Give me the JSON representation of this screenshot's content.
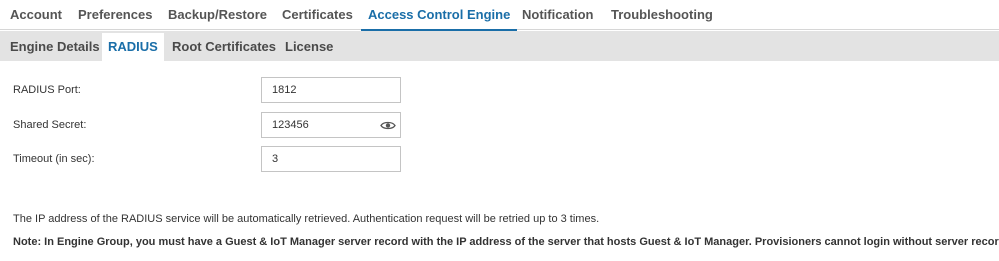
{
  "top_tabs": [
    "Account",
    "Preferences",
    "Backup/Restore",
    "Certificates",
    "Access Control Engine",
    "Notification",
    "Troubleshooting"
  ],
  "active_top_tab": "Access Control Engine",
  "sub_tabs": [
    "Engine Details",
    "RADIUS",
    "Root Certificates",
    "License"
  ],
  "active_sub_tab": "RADIUS",
  "form": {
    "radius_port": {
      "label": "RADIUS Port:",
      "value": "1812"
    },
    "shared_secret": {
      "label": "Shared Secret:",
      "value": "123456",
      "icon": "eye-icon"
    },
    "timeout": {
      "label": "Timeout (in sec):",
      "value": "3"
    }
  },
  "info_text": "The IP address of the RADIUS service will be automatically retrieved. Authentication request will be retried up to 3 times.",
  "note_text": "Note: In Engine Group, you must have a Guest & IoT Manager server record with the IP address of the server that hosts Guest & IoT Manager. Provisioners cannot login without server record.",
  "colors": {
    "accent": "#1a6ea8",
    "subtab_bar": "#e3e3e3",
    "border": "#c4c4c4"
  }
}
